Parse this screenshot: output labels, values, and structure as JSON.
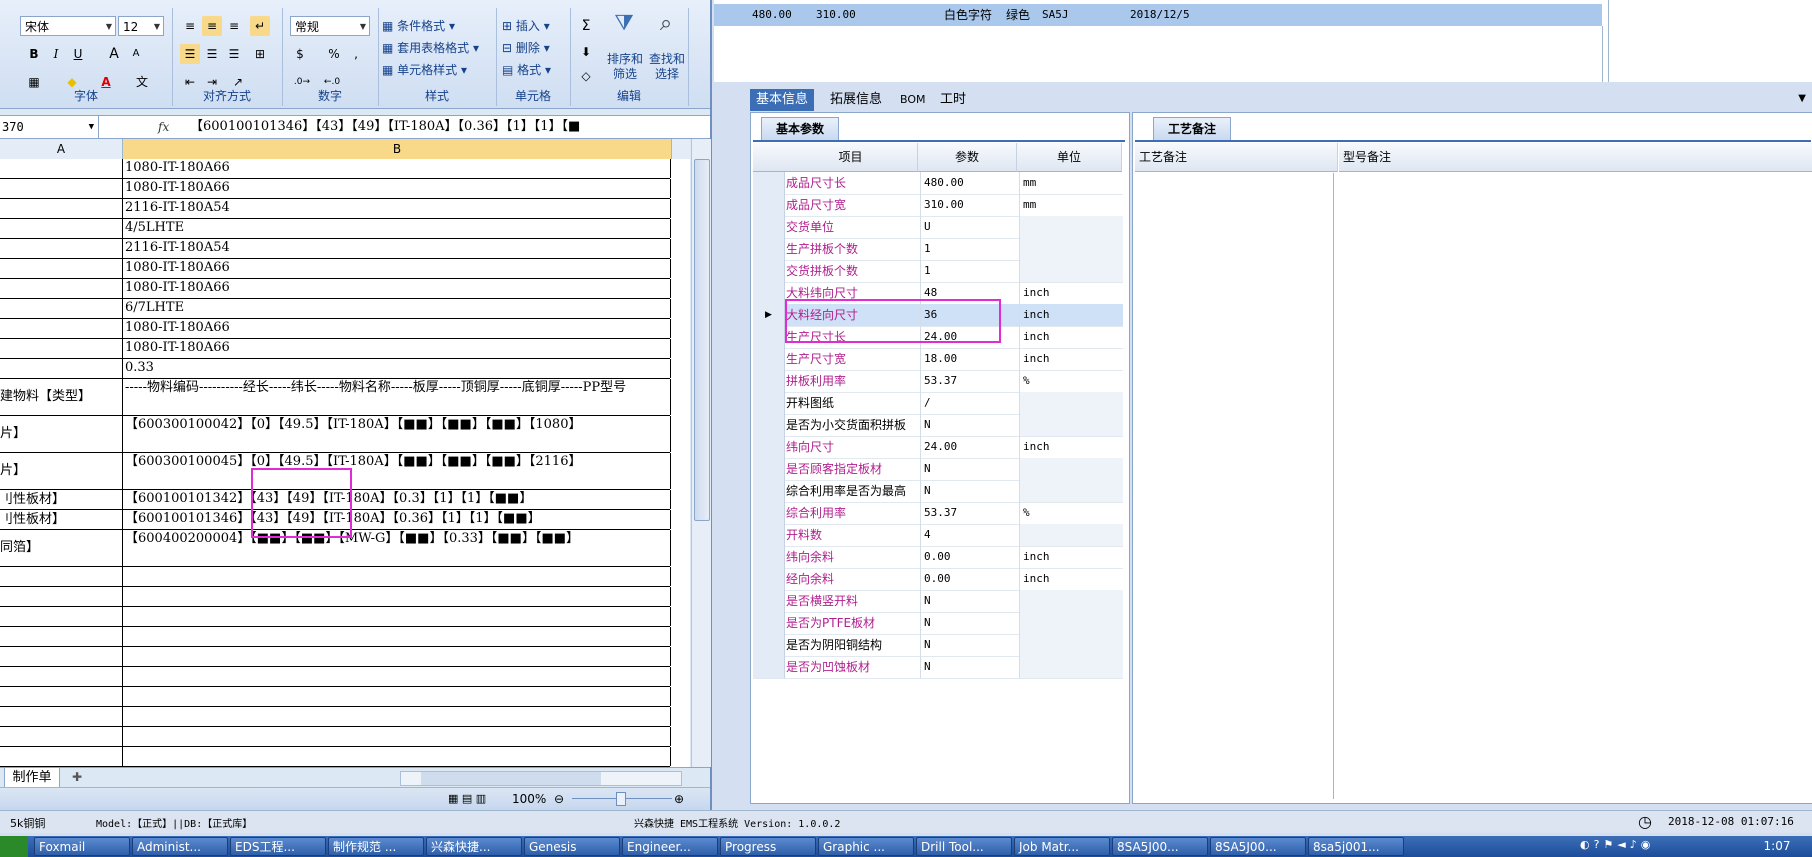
{
  "excel": {
    "font_name": "宋体",
    "font_size": "12",
    "number_format": "常规",
    "groups": {
      "font": "字体",
      "align": "对齐方式",
      "number": "数字",
      "styles": "样式",
      "cells": "单元格",
      "edit": "编辑"
    },
    "styles_buttons": [
      "条件格式",
      "套用表格格式",
      "单元格样式"
    ],
    "cells_buttons": [
      "插入",
      "删除",
      "格式"
    ],
    "edit_buttons": {
      "sort": "排序和\n筛选",
      "find": "查找和\n选择"
    },
    "format_buttons": {
      "bold": "B",
      "italic": "I",
      "underline": "U",
      "grow": "A",
      "shrink": "A"
    },
    "number_buttons": {
      "percent": "%",
      "comma": ","
    },
    "sigma": "Σ",
    "namebox": "370",
    "fx": "fx",
    "formula": "【600100101346】【43】【49】【IT-180A】【0.36】【1】【1】【■",
    "col_a": "A",
    "col_b": "B",
    "rows": [
      {
        "a": "",
        "b": "1080-IT-180A66"
      },
      {
        "a": "",
        "b": "1080-IT-180A66"
      },
      {
        "a": "",
        "b": "2116-IT-180A54"
      },
      {
        "a": "",
        "b": "4/5LHTE"
      },
      {
        "a": "",
        "b": "2116-IT-180A54"
      },
      {
        "a": "",
        "b": "1080-IT-180A66"
      },
      {
        "a": "",
        "b": "1080-IT-180A66"
      },
      {
        "a": "",
        "b": "6/7LHTE"
      },
      {
        "a": "",
        "b": "1080-IT-180A66"
      },
      {
        "a": "",
        "b": "1080-IT-180A66"
      },
      {
        "a": "",
        "b": "0.33"
      },
      {
        "a": "建物料【类型】",
        "b": "-----物料编码----------经长-----纬长-----物料名称-----板厚-----顶铜厚-----底铜厚-----PP型号"
      },
      {
        "a": "片】",
        "b": "【600300100042】【0】【49.5】【IT-180A】【■■】【■■】【■■】【1080】"
      },
      {
        "a": "片】",
        "b": "【600300100045】【0】【49.5】【IT-180A】【■■】【■■】【■■】【2116】"
      },
      {
        "a": "刂性板材】",
        "b": "【600100101342】【43】【49】【IT-180A】【0.3】【1】【1】【■■】"
      },
      {
        "a": "刂性板材】",
        "b": "【600100101346】【43】【49】【IT-180A】【0.36】【1】【1】【■■】"
      },
      {
        "a": "同箔】",
        "b": "【600400200004】【■■】【■■】【MW-G】【■■】【0.33】【■■】【■■】"
      }
    ],
    "sheet_tab": "制作单",
    "zoom": "100%"
  },
  "top_record": {
    "len": "480.00",
    "wid": "310.00",
    "char": "白色字符",
    "color": "绿色",
    "code": "SA5J",
    "date": "2018/12/5"
  },
  "tabs": [
    "基本信息",
    "拓展信息",
    "BOM",
    "工时"
  ],
  "basic_tab": "基本参数",
  "process_tab": "工艺备注",
  "headers": {
    "item": "项目",
    "param": "参数",
    "unit": "单位"
  },
  "params": [
    {
      "name": "成品尺寸长",
      "value": "480.00",
      "unit": "mm",
      "hl": true
    },
    {
      "name": "成品尺寸宽",
      "value": "310.00",
      "unit": "mm",
      "hl": true
    },
    {
      "name": "交货单位",
      "value": "U",
      "unit": "",
      "hl": true
    },
    {
      "name": "生产拼板个数",
      "value": "1",
      "unit": "",
      "hl": true
    },
    {
      "name": "交货拼板个数",
      "value": "1",
      "unit": "",
      "hl": true
    },
    {
      "name": "大料纬向尺寸",
      "value": "48",
      "unit": "inch",
      "hl": true
    },
    {
      "name": "大料经向尺寸",
      "value": "36",
      "unit": "inch",
      "hl": true
    },
    {
      "name": "生产尺寸长",
      "value": "24.00",
      "unit": "inch",
      "hl": true
    },
    {
      "name": "生产尺寸宽",
      "value": "18.00",
      "unit": "inch",
      "hl": true
    },
    {
      "name": "拼板利用率",
      "value": "53.37",
      "unit": "%",
      "hl": true
    },
    {
      "name": "开料图纸",
      "value": "/",
      "unit": "",
      "hl": false
    },
    {
      "name": "是否为小交货面积拼板",
      "value": "N",
      "unit": "",
      "hl": false
    },
    {
      "name": "纬向尺寸",
      "value": "24.00",
      "unit": "inch",
      "hl": true
    },
    {
      "name": "是否顾客指定板材",
      "value": "N",
      "unit": "",
      "hl": true
    },
    {
      "name": "综合利用率是否为最高",
      "value": "N",
      "unit": "",
      "hl": false
    },
    {
      "name": "综合利用率",
      "value": "53.37",
      "unit": "%",
      "hl": true
    },
    {
      "name": "开料数",
      "value": "4",
      "unit": "",
      "hl": true
    },
    {
      "name": "纬向余料",
      "value": "0.00",
      "unit": "inch",
      "hl": true
    },
    {
      "name": "经向余料",
      "value": "0.00",
      "unit": "inch",
      "hl": true
    },
    {
      "name": "是否横竖开料",
      "value": "N",
      "unit": "",
      "hl": true
    },
    {
      "name": "是否为PTFE板材",
      "value": "N",
      "unit": "",
      "hl": true
    },
    {
      "name": "是否为阴阳铜结构",
      "value": "N",
      "unit": "",
      "hl": false
    },
    {
      "name": "是否为凹蚀板材",
      "value": "N",
      "unit": "",
      "hl": true
    }
  ],
  "remarks": {
    "process": "工艺备注",
    "model": "型号备注"
  },
  "status": {
    "left": "5k铜铜",
    "model": "Model:【正式】||DB:【正式库】",
    "app": "兴森快捷 EMS工程系统 Version: 1.0.0.2",
    "datetime": "2018-12-08 01:07:16"
  },
  "taskbar": [
    "Foxmail",
    "Administ...",
    "EDS工程...",
    "制作规范 ...",
    "兴森快捷...",
    "Genesis",
    "Engineer...",
    "Progress",
    "Graphic ...",
    "Drill Tool...",
    "Job Matr...",
    "8SA5J00...",
    "8SA5J00...",
    "8sa5j001..."
  ],
  "clock": "1:07",
  "colors": {
    "accent": "#3b6eb4",
    "highlight_text": "#b0208e",
    "annotation": "#e02cd6"
  }
}
